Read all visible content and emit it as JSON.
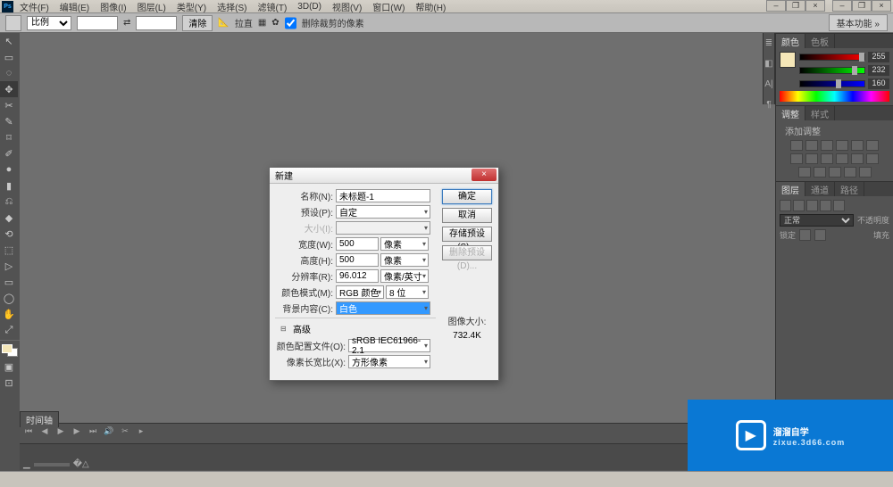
{
  "app": {
    "logo": "Ps"
  },
  "menu": [
    "文件(F)",
    "编辑(E)",
    "图像(I)",
    "图层(L)",
    "类型(Y)",
    "选择(S)",
    "滤镜(T)",
    "3D(D)",
    "视图(V)",
    "窗口(W)",
    "帮助(H)"
  ],
  "optbar": {
    "ratio_label": "比例",
    "swap": "⇄",
    "clear": "清除",
    "straighten": "拉直",
    "grid": "▦",
    "gear": "✿",
    "delete_label": "删除裁剪的像素",
    "workspace": "基本功能"
  },
  "tools": [
    "↖",
    "▭",
    "◌",
    "✥",
    "✂",
    "✎",
    "⌑",
    "✐",
    "●",
    "▮",
    "⎌",
    "◆",
    "⟲",
    "⬚",
    "✋",
    "T",
    "▷",
    "▭",
    "◯",
    "✋",
    "⤢"
  ],
  "panels": {
    "color": {
      "tabs": [
        "颜色",
        "色板"
      ],
      "values": [
        "255",
        "232",
        "160"
      ]
    },
    "adjust": {
      "tabs": [
        "调整",
        "样式"
      ],
      "add_label": "添加调整"
    },
    "layers": {
      "tabs": [
        "图层",
        "通道",
        "路径"
      ],
      "mode": "正常",
      "opacity_label": "不透明度",
      "lock_label": "锁定",
      "fill_label": "填充"
    }
  },
  "timeline": {
    "tab": "时间轴"
  },
  "dialog": {
    "title": "新建",
    "name_label": "名称(N):",
    "name_value": "未标题-1",
    "preset_label": "预设(P):",
    "preset_value": "自定",
    "size_label": "大小(I):",
    "width_label": "宽度(W):",
    "width_value": "500",
    "width_unit": "像素",
    "height_label": "高度(H):",
    "height_value": "500",
    "height_unit": "像素",
    "res_label": "分辨率(R):",
    "res_value": "96.012",
    "res_unit": "像素/英寸",
    "mode_label": "颜色模式(M):",
    "mode_value": "RGB 颜色",
    "depth_value": "8 位",
    "bg_label": "背景内容(C):",
    "bg_value": "白色",
    "advanced": "高级",
    "profile_label": "颜色配置文件(O):",
    "profile_value": "sRGB IEC61966-2.1",
    "aspect_label": "像素长宽比(X):",
    "aspect_value": "方形像素",
    "ok": "确定",
    "cancel": "取消",
    "save_preset": "存储预设(S)...",
    "delete_preset": "删除预设(D)...",
    "imgsize_label": "图像大小:",
    "imgsize_value": "732.4K"
  },
  "watermark": {
    "brand": "溜溜自学",
    "sub": "zixue.3d66.com"
  }
}
